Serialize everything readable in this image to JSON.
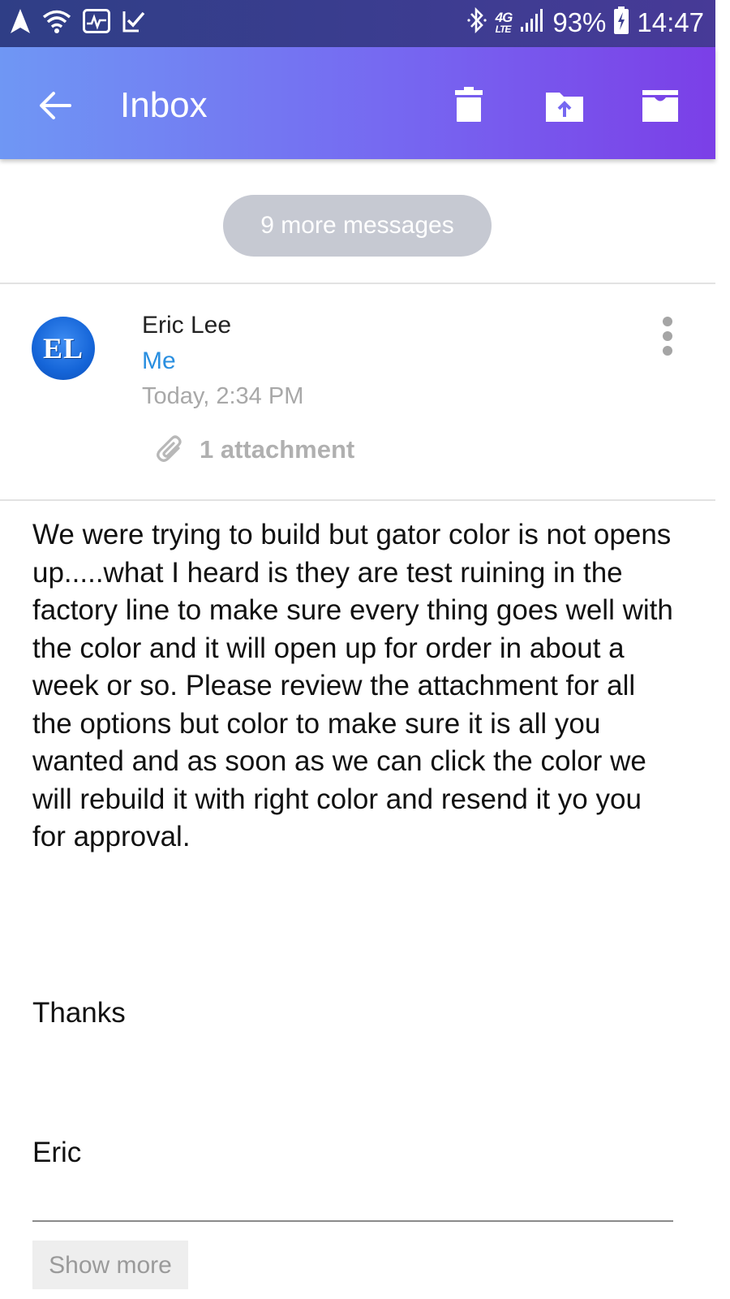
{
  "status_bar": {
    "left_icons": [
      "navigation-arrow-icon",
      "wifi-icon",
      "pulse-app-icon",
      "check-app-icon"
    ],
    "right_icons": [
      "bluetooth-icon",
      "signal-bars-icon",
      "battery-charging-icon"
    ],
    "network_top": "4G",
    "network_bottom": "LTE",
    "battery": "93%",
    "time": "14:47"
  },
  "header": {
    "title": "Inbox",
    "back_icon": "arrow-left-icon",
    "actions": [
      {
        "icon": "trash-icon"
      },
      {
        "icon": "folder-move-icon"
      },
      {
        "icon": "archive-icon"
      }
    ],
    "gradient_start": "#6f97f4",
    "gradient_end": "#7b3fe7"
  },
  "thread": {
    "more_messages": "9 more messages"
  },
  "message": {
    "avatar_initials": "EL",
    "sender": "Eric Lee",
    "recipient": "Me",
    "date": "Today, 2:34 PM",
    "attachment_label": "1 attachment",
    "attachment_icon": "paperclip-icon",
    "menu_icon": "more-vertical-icon",
    "body": "We were trying to build but gator color is not opens up.....what I heard is they are test ruining in the factory line to make sure every thing goes well with the color and it will open up for order in about a week or so. Please review the attachment for all the options but color to make sure it is all you wanted and as soon as we can click the color we will rebuild it with right color and resend it yo you for approval.",
    "closing": "Thanks",
    "signature": "Eric",
    "show_more_label": "Show more",
    "recipient_color": "#2a8fe0"
  }
}
